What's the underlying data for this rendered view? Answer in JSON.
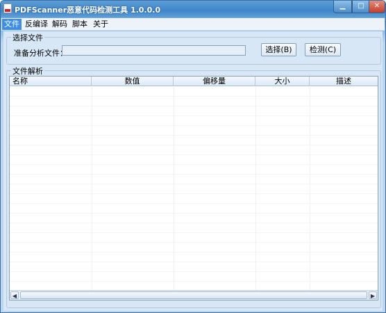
{
  "window": {
    "title": "PDFScanner恶意代码检测工具 1.0.0.0"
  },
  "menu": {
    "items": [
      {
        "label": "文件",
        "active": true
      },
      {
        "label": "反编译"
      },
      {
        "label": "解码"
      },
      {
        "label": "脚本"
      },
      {
        "label": "关于"
      }
    ]
  },
  "select_group": {
    "title": "选择文件",
    "file_label": "准备分析文件：",
    "path_value": "",
    "select_button": "选择(B)",
    "detect_button": "检测(C)"
  },
  "parse_group": {
    "title": "文件解析",
    "columns": [
      "名称",
      "数值",
      "偏移量",
      "大小",
      "描述"
    ]
  },
  "icons": {
    "app": "pdf-document-icon",
    "minimize": "minimize-icon",
    "maximize": "maximize-icon",
    "close": "close-icon",
    "scroll_left": "arrow-left-icon",
    "scroll_right": "arrow-right-icon"
  }
}
